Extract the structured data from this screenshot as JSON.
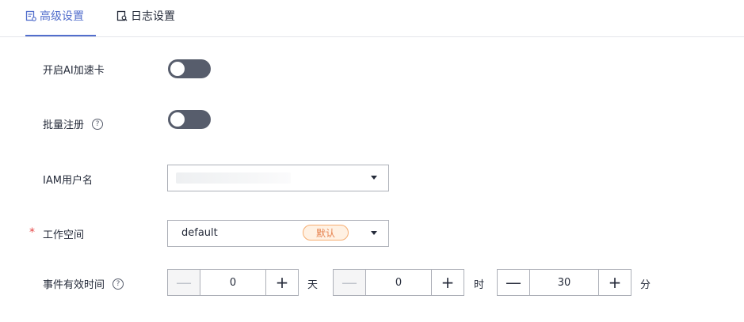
{
  "tabs": [
    {
      "label": "高级设置",
      "icon": "document-settings-icon",
      "active": true
    },
    {
      "label": "日志设置",
      "icon": "log-search-icon",
      "active": false
    }
  ],
  "colors": {
    "accent": "#526ecc",
    "required": "#e54545",
    "switch_off": "#575d6c",
    "badge_text": "#e6804c"
  },
  "form": {
    "ai_accel": {
      "label": "开启AI加速卡",
      "enabled": false
    },
    "batch_register": {
      "label": "批量注册",
      "help_icon": "?",
      "enabled": false
    },
    "iam_user": {
      "label": "IAM用户名",
      "value": ""
    },
    "workspace": {
      "label": "工作空间",
      "required_mark": "*",
      "value": "default",
      "badge": "默认"
    },
    "event_validity": {
      "label": "事件有效时间",
      "help_icon": "?",
      "days": {
        "value": "0",
        "unit": "天"
      },
      "hours": {
        "value": "0",
        "unit": "时"
      },
      "minutes": {
        "value": "30",
        "unit": "分"
      },
      "minus": "—",
      "plus": "+"
    }
  }
}
